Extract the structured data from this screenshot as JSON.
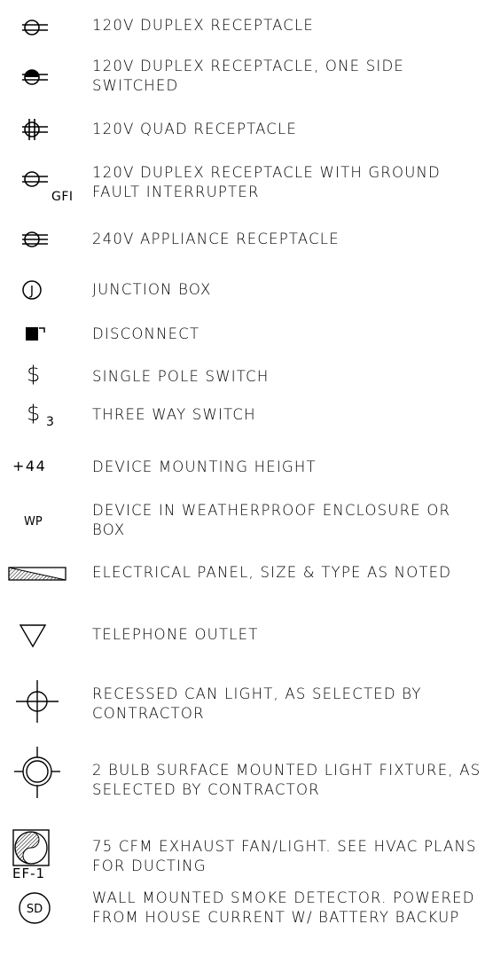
{
  "legend": {
    "items": [
      {
        "icon": "duplex-receptacle-icon",
        "label": "120V DUPLEX RECEPTACLE"
      },
      {
        "icon": "half-switched-receptacle-icon",
        "label": "120V DUPLEX RECEPTACLE, ONE SIDE SWITCHED"
      },
      {
        "icon": "quad-receptacle-icon",
        "label": "120V QUAD RECEPTACLE"
      },
      {
        "icon": "gfi-receptacle-icon",
        "symbol_text": "GFI",
        "label": "120V DUPLEX RECEPTACLE WITH GROUND FAULT INTERRUPTER"
      },
      {
        "icon": "appliance-receptacle-icon",
        "label": "240V APPLIANCE RECEPTACLE"
      },
      {
        "icon": "junction-box-icon",
        "symbol_text": "J",
        "label": "JUNCTION BOX"
      },
      {
        "icon": "disconnect-icon",
        "label": "DISCONNECT"
      },
      {
        "icon": "single-pole-switch-icon",
        "symbol_text": "$",
        "label": "SINGLE POLE SWITCH"
      },
      {
        "icon": "three-way-switch-icon",
        "symbol_text": "$",
        "symbol_sub": "3",
        "label": "THREE WAY SWITCH"
      },
      {
        "icon": "mounting-height-icon",
        "symbol_text": "+44",
        "label": "DEVICE MOUNTING HEIGHT"
      },
      {
        "icon": "weatherproof-icon",
        "symbol_text": "WP",
        "label": "DEVICE IN WEATHERPROOF ENCLOSURE OR BOX"
      },
      {
        "icon": "electrical-panel-icon",
        "label": "ELECTRICAL PANEL, SIZE & TYPE AS NOTED"
      },
      {
        "icon": "telephone-outlet-icon",
        "label": "TELEPHONE OUTLET"
      },
      {
        "icon": "recessed-can-light-icon",
        "label": "RECESSED CAN LIGHT, AS SELECTED BY CONTRACTOR"
      },
      {
        "icon": "surface-light-fixture-icon",
        "label": "2 BULB SURFACE MOUNTED LIGHT FIXTURE, AS SELECTED BY CONTRACTOR"
      },
      {
        "icon": "exhaust-fan-icon",
        "symbol_text": "EF-1",
        "label": "75 CFM EXHAUST FAN/LIGHT. SEE HVAC PLANS FOR DUCTING"
      },
      {
        "icon": "smoke-detector-icon",
        "symbol_text": "SD",
        "label": "WALL MOUNTED SMOKE DETECTOR. POWERED FROM HOUSE CURRENT W/ BATTERY BACKUP"
      }
    ]
  }
}
